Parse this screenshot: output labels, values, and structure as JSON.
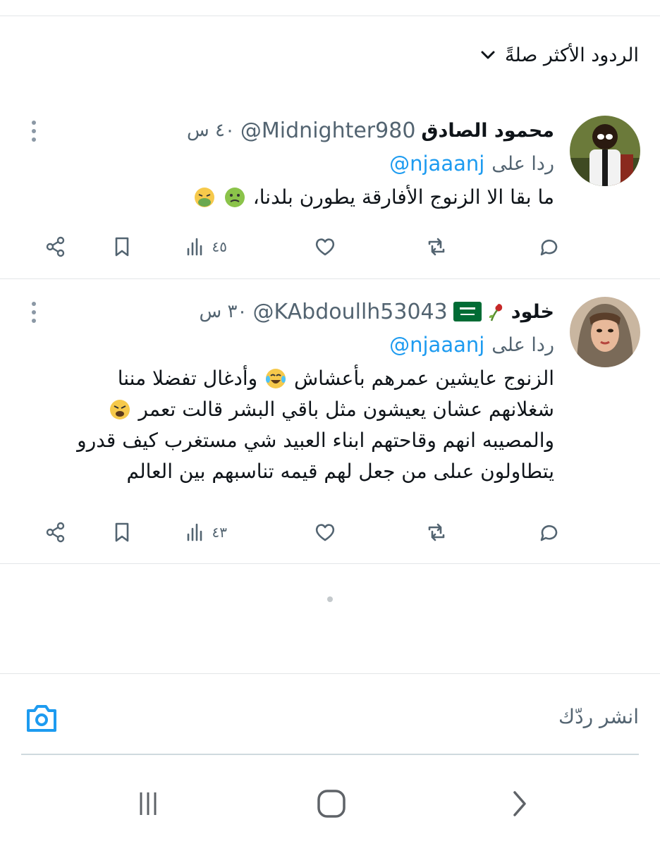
{
  "sort": {
    "label": "الردود الأكثر صلةً",
    "chevron_icon": "chevron-down-icon"
  },
  "tweets": [
    {
      "name": "محمود الصادق",
      "handle": "@Midnighter980",
      "time": "٤٠ س",
      "reply_prefix": "ردا على",
      "reply_to": "@njaaanj",
      "text": "ما بقا  الا الزنوج الأفارقة يطورن بلدنا،",
      "emojis": [
        "nauseated-face-emoji",
        "vomiting-face-emoji"
      ],
      "views": "٤٥"
    },
    {
      "name": "خلود",
      "name_decor": [
        "wilted-rose-emoji",
        "saudi-flag-emoji"
      ],
      "handle": "@KAbdoullh53043",
      "time": "٣٠ س",
      "reply_prefix": "ردا على",
      "reply_to": "@njaaanj",
      "text_line1": "الزنوج عايشين عمرهم بأعشاش",
      "text_line1b": "وأدغال تفضلا مننا",
      "text_line2": "شغلانهم عشان يعيشون مثل باقي البشر قالت تعمر",
      "text_line3": "والمصيبه انهم وقاحتهم ابناء العبيد شي مستغرب كيف قدرو",
      "text_line4": "يتطاولون عىلى من جعل لهم قيمه تناسبهم بين العالم",
      "views": "٤٣"
    }
  ],
  "compose": {
    "placeholder": "انشر ردّك",
    "camera_icon": "camera-icon"
  },
  "colors": {
    "accent": "#1d9bf0",
    "muted": "#536471",
    "text": "#0f1419",
    "divider": "#e3e6e8"
  }
}
